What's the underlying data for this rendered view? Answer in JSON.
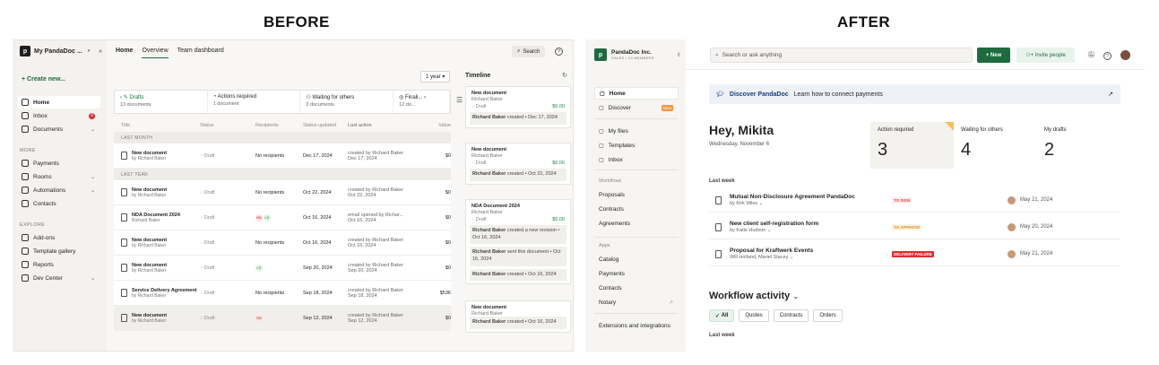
{
  "titles": {
    "before": "BEFORE",
    "after": "AFTER"
  },
  "before": {
    "workspace": "My PandaDoc ...",
    "create_new": "Create new...",
    "nav": [
      {
        "label": "Home",
        "icon": "home-icon",
        "active": true
      },
      {
        "label": "Inbox",
        "icon": "inbox-icon",
        "badge": "9"
      },
      {
        "label": "Documents",
        "icon": "documents-icon",
        "chevron": true
      }
    ],
    "more_label": "MORE",
    "more": [
      {
        "label": "Payments",
        "icon": "payments-icon"
      },
      {
        "label": "Rooms",
        "icon": "rooms-icon",
        "chevron": true
      },
      {
        "label": "Automations",
        "icon": "automations-icon",
        "chevron": true
      },
      {
        "label": "Contacts",
        "icon": "contacts-icon"
      }
    ],
    "explore_label": "EXPLORE",
    "explore": [
      {
        "label": "Add-ons",
        "icon": "addons-icon"
      },
      {
        "label": "Template gallery",
        "icon": "template-gallery-icon"
      },
      {
        "label": "Reports",
        "icon": "reports-icon"
      },
      {
        "label": "Dev Center",
        "icon": "dev-center-icon",
        "chevron": true
      }
    ],
    "tabs": [
      "Home",
      "Overview",
      "Team dashboard"
    ],
    "search": "Search",
    "year": "1 year",
    "cards": [
      {
        "label": "Drafts",
        "count": "13 documents"
      },
      {
        "label": "Actions required",
        "count": "1 document"
      },
      {
        "label": "Waiting for others",
        "count": "0 documents"
      },
      {
        "label": "Finali...",
        "count": "12 do..."
      }
    ],
    "columns": [
      "Title",
      "Status",
      "Recipients",
      "Status updated",
      "Last action",
      "Value"
    ],
    "groups": [
      {
        "label": "LAST MONTH",
        "rows": [
          {
            "name": "New document",
            "by": "by Richard Baker",
            "status": "Draft",
            "recipients": "No recipients",
            "updated": "Dec 17, 2024",
            "action1": "created by Richard Baker",
            "action2": "Dec 17, 2024",
            "value": "$0"
          }
        ]
      },
      {
        "label": "LAST YEAR",
        "rows": [
          {
            "name": "New document",
            "by": "by Richard Baker",
            "status": "Draft",
            "recipients": "No recipients",
            "updated": "Oct 22, 2024",
            "action1": "created by Richard Baker",
            "action2": "Oct 22, 2024",
            "value": "$0"
          },
          {
            "name": "NDA Document 2024",
            "by": "Richard Baker",
            "status": "Draft",
            "avatars": [
              "RB",
              "LS"
            ],
            "updated": "Oct 16, 2024",
            "action1": "email opened by Richar...",
            "action2": "Oct 16, 2024",
            "value": "$0"
          },
          {
            "name": "New document",
            "by": "by Richard Baker",
            "status": "Draft",
            "recipients": "No recipients",
            "updated": "Oct 16, 2024",
            "action1": "created by Richard Baker",
            "action2": "Oct 16, 2024",
            "value": "$0"
          },
          {
            "name": "New document",
            "by": "by Richard Baker",
            "status": "Draft",
            "avatars": [
              "LS"
            ],
            "updated": "Sep 20, 2024",
            "action1": "created by Richard Baker",
            "action2": "Sep 20, 2024",
            "value": "$0"
          },
          {
            "name": "Service Delivery Agreement",
            "by": "by Richard Baker",
            "status": "Draft",
            "recipients": "No recipients",
            "updated": "Sep 18, 2024",
            "action1": "created by Richard Baker",
            "action2": "Sep 18, 2024",
            "value": "$536"
          },
          {
            "name": "New document",
            "by": "by Richard Baker",
            "status": "Draft",
            "avatars": [
              "RB"
            ],
            "updated": "Sep 12, 2024",
            "action1": "created by Richard Baker",
            "action2": "Sep 12, 2024",
            "value": "$0"
          }
        ]
      }
    ],
    "timeline": {
      "title": "Timeline",
      "items": [
        {
          "name": "New document",
          "by": "Richard Baker",
          "status": "Draft",
          "amount": "$0.00",
          "events": [
            {
              "who": "Richard Baker",
              "text": "created • Dec 17, 2024"
            }
          ]
        },
        {
          "name": "New document",
          "by": "Richard Baker",
          "status": "Draft",
          "amount": "$0.00",
          "events": [
            {
              "who": "Richard Baker",
              "text": "created • Oct 22, 2024"
            }
          ]
        },
        {
          "name": "NDA Document 2024",
          "by": "Richard Baker",
          "status": "Draft",
          "amount": "$0.00",
          "events": [
            {
              "who": "Richard Baker",
              "text": "created a new revision • Oct 16, 2024"
            },
            {
              "who": "Richard Baker",
              "text": "sent this document • Oct 16, 2024"
            },
            {
              "who": "Richard Baker",
              "text": "created • Oct 16, 2024"
            }
          ]
        },
        {
          "name": "New document",
          "by": "Richard Baker",
          "status": "",
          "amount": "",
          "events": [
            {
              "who": "Richard Baker",
              "text": "created • Oct 16, 2024"
            }
          ]
        }
      ]
    }
  },
  "after": {
    "workspace": "PandaDoc Inc.",
    "workspace_sub": "SALES • 24 MEMBERS",
    "nav": [
      {
        "label": "Home",
        "icon": "home-icon",
        "active": true
      },
      {
        "label": "Discover",
        "icon": "discover-icon",
        "new": "NEW"
      }
    ],
    "nav2": [
      {
        "label": "My files",
        "icon": "files-icon"
      },
      {
        "label": "Templates",
        "icon": "templates-icon"
      },
      {
        "label": "Inbox",
        "icon": "inbox-icon"
      }
    ],
    "workflows_label": "Workflows",
    "workflows": [
      "Proposals",
      "Contracts",
      "Agreements"
    ],
    "apps_label": "Apps",
    "apps": [
      "Catalog",
      "Payments",
      "Contacts",
      "Notary"
    ],
    "extensions": "Extensions and integrations",
    "search_placeholder": "Search or ask anything",
    "new_btn": "New",
    "invite_btn": "Invite people",
    "banner_title": "Discover PandaDoc",
    "banner_text": "Learn how to connect payments",
    "greeting": "Hey, Mikita",
    "date": "Wednesday, November 6",
    "counters": [
      {
        "label": "Action required",
        "value": "3"
      },
      {
        "label": "Waiting for others",
        "value": "4"
      },
      {
        "label": "My drafts",
        "value": "2"
      }
    ],
    "last_week": "Last week",
    "rows": [
      {
        "name": "Mutual Non-Disclosure Agreement PandaDoc",
        "by": "by Kirk Miles",
        "tag": "TO SIGN",
        "tag_color": "#e04646",
        "tag_bg": "#fdecec",
        "date": "May 21, 2024"
      },
      {
        "name": "New client self-registration form",
        "by": "by Katie Hudson",
        "tag": "TO APPROVE",
        "tag_color": "#e08a1e",
        "tag_bg": "#fdf2e3",
        "date": "May 20, 2024"
      },
      {
        "name": "Proposal for Kraftwerk Events",
        "by": "Will Holland, Mariel Stacey",
        "tag": "DELIVERY FAILURE",
        "tag_color": "#ffffff",
        "tag_bg": "#d93030",
        "date": "May 21, 2024"
      }
    ],
    "workflow_activity": "Workflow activity",
    "chips": [
      "All",
      "Quotes",
      "Contracts",
      "Orders"
    ],
    "last_week2": "Last week"
  }
}
